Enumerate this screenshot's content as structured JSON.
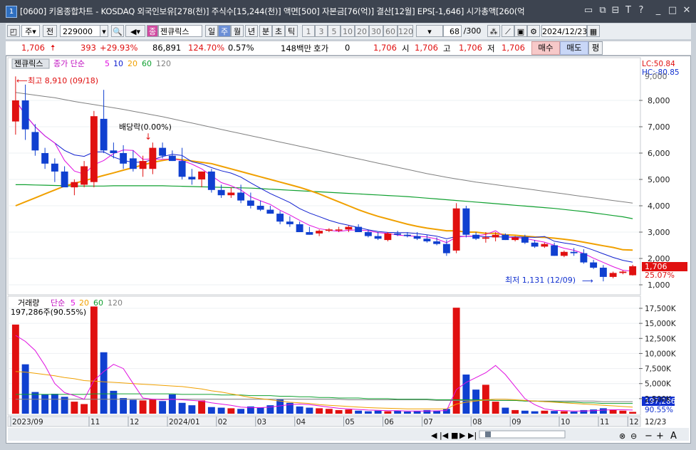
{
  "title": {
    "window_number": "1",
    "text": "[0600] 키움종합차트 - KOSDAQ 외국인보유[278(천)] 주식수[15,244(천)] 액면[500] 자본금[76(억)] 결산[12월] EPS[-1,646] 시가총액[260(억"
  },
  "toolbar": {
    "period": "주",
    "prev": "전",
    "code": "229000",
    "stock_badge": "종",
    "stock_name": "젠큐릭스",
    "tf_day": "일",
    "tf_week": "주",
    "tf_month": "월",
    "tf_year": "년",
    "tf_min": "분",
    "tf_sec": "초",
    "tf_tick": "틱",
    "intervals": [
      "1",
      "3",
      "5",
      "10",
      "20",
      "30",
      "60",
      "120"
    ],
    "count": "68",
    "count_total": "/300",
    "date": "2024/12/23"
  },
  "quote": {
    "price": "1,706",
    "change": "393",
    "change_pct": "+29.93%",
    "volume": "86,891",
    "vol_ratio": "124.70%",
    "turnover": "0.57%",
    "amount": "148백만",
    "hoga_label": "호가",
    "hoga_value": "0",
    "hoga_price": "1,706",
    "open_label": "시",
    "open": "1,706",
    "high_label": "고",
    "high": "1,706",
    "low_label": "저",
    "low": "1,706",
    "buy_label": "매수",
    "sell_label": "매도",
    "avg_label": "평"
  },
  "price_panel": {
    "name_tag": "젠큐릭스",
    "legend_prefix": "종가 단순",
    "ma_periods": [
      "5",
      "10",
      "20",
      "60",
      "120"
    ],
    "ma_colors": [
      "#e010e0",
      "#1020d0",
      "#f0a000",
      "#10a030",
      "#808080"
    ],
    "lc": "LC:50.84",
    "hc": "HC:-80.85",
    "high_note": "최고 8,910 (09/18)",
    "dividend_note": "배당락(0.00%)",
    "low_note": "최저 1,131 (12/09)",
    "last_price": "1,706",
    "last_pct": "25.07%",
    "y_labels": [
      "8,000",
      "7,000",
      "6,000",
      "5,000",
      "4,000",
      "3,000",
      "2,000",
      "1,000"
    ],
    "y_top_label": "9,000"
  },
  "volume_panel": {
    "name_tag": "거래량",
    "legend_prefix": "단순",
    "ma_periods": [
      "5",
      "20",
      "60",
      "120"
    ],
    "info": "197,286주(90.55%)",
    "y_labels": [
      "17,500K",
      "15,000K",
      "12,500K",
      "10,000K",
      "7,500K",
      "5,000K",
      "2,500K"
    ],
    "last_volume": "197,286",
    "last_pct": "90.55%"
  },
  "x_axis": {
    "labels": [
      "2023/09",
      "11",
      "12",
      "2024/01",
      "02",
      "03",
      "04",
      "05",
      "06",
      "07",
      "08",
      "09",
      "10",
      "11",
      "12",
      "12/23"
    ]
  },
  "chart_data": {
    "type": "candlestick",
    "weeks": [
      {
        "o": 7200,
        "h": 8910,
        "l": 6700,
        "c": 8000
      },
      {
        "o": 8000,
        "h": 8600,
        "l": 6500,
        "c": 6900
      },
      {
        "o": 6800,
        "h": 7100,
        "l": 5900,
        "c": 6100
      },
      {
        "o": 6000,
        "h": 6200,
        "l": 5400,
        "c": 5600
      },
      {
        "o": 5600,
        "h": 5800,
        "l": 4900,
        "c": 5300
      },
      {
        "o": 5300,
        "h": 5500,
        "l": 4800,
        "c": 4700
      },
      {
        "o": 4700,
        "h": 5000,
        "l": 4400,
        "c": 4900
      },
      {
        "o": 4800,
        "h": 5700,
        "l": 4700,
        "c": 5500
      },
      {
        "o": 4900,
        "h": 7600,
        "l": 4700,
        "c": 7400
      },
      {
        "o": 7300,
        "h": 8400,
        "l": 6000,
        "c": 6100
      },
      {
        "o": 6100,
        "h": 6400,
        "l": 5800,
        "c": 6000
      },
      {
        "o": 6000,
        "h": 6300,
        "l": 5400,
        "c": 5600
      },
      {
        "o": 5800,
        "h": 6100,
        "l": 5300,
        "c": 5400
      },
      {
        "o": 5400,
        "h": 5900,
        "l": 5100,
        "c": 5700
      },
      {
        "o": 5400,
        "h": 6400,
        "l": 5200,
        "c": 6200
      },
      {
        "o": 6200,
        "h": 6400,
        "l": 5800,
        "c": 5900
      },
      {
        "o": 5900,
        "h": 6100,
        "l": 5700,
        "c": 5700
      },
      {
        "o": 5700,
        "h": 6200,
        "l": 5000,
        "c": 5100
      },
      {
        "o": 5100,
        "h": 5400,
        "l": 4800,
        "c": 5000
      },
      {
        "o": 5000,
        "h": 5300,
        "l": 4700,
        "c": 5300
      },
      {
        "o": 5300,
        "h": 5400,
        "l": 4500,
        "c": 4600
      },
      {
        "o": 4600,
        "h": 4800,
        "l": 4300,
        "c": 4400
      },
      {
        "o": 4400,
        "h": 4700,
        "l": 4300,
        "c": 4500
      },
      {
        "o": 4500,
        "h": 4800,
        "l": 4100,
        "c": 4200
      },
      {
        "o": 4200,
        "h": 4500,
        "l": 3900,
        "c": 4000
      },
      {
        "o": 4000,
        "h": 4200,
        "l": 3800,
        "c": 3850
      },
      {
        "o": 3850,
        "h": 4000,
        "l": 3700,
        "c": 3700
      },
      {
        "o": 3700,
        "h": 3800,
        "l": 3300,
        "c": 3400
      },
      {
        "o": 3400,
        "h": 3600,
        "l": 3200,
        "c": 3300
      },
      {
        "o": 3300,
        "h": 3400,
        "l": 3000,
        "c": 3000
      },
      {
        "o": 3000,
        "h": 3200,
        "l": 2900,
        "c": 2900
      },
      {
        "o": 2950,
        "h": 3100,
        "l": 2850,
        "c": 3050
      },
      {
        "o": 3050,
        "h": 3150,
        "l": 3000,
        "c": 3100
      },
      {
        "o": 3100,
        "h": 3200,
        "l": 3000,
        "c": 3100
      },
      {
        "o": 3100,
        "h": 3250,
        "l": 3000,
        "c": 3200
      },
      {
        "o": 3200,
        "h": 3300,
        "l": 3000,
        "c": 3000
      },
      {
        "o": 3000,
        "h": 3100,
        "l": 2800,
        "c": 2850
      },
      {
        "o": 2850,
        "h": 3000,
        "l": 2700,
        "c": 2750
      },
      {
        "o": 2700,
        "h": 3000,
        "l": 2650,
        "c": 2950
      },
      {
        "o": 2950,
        "h": 3050,
        "l": 2850,
        "c": 2900
      },
      {
        "o": 2900,
        "h": 3000,
        "l": 2800,
        "c": 2850
      },
      {
        "o": 2850,
        "h": 3000,
        "l": 2700,
        "c": 2750
      },
      {
        "o": 2750,
        "h": 2900,
        "l": 2600,
        "c": 2650
      },
      {
        "o": 2650,
        "h": 2800,
        "l": 2500,
        "c": 2550
      },
      {
        "o": 2550,
        "h": 2700,
        "l": 2100,
        "c": 2200
      },
      {
        "o": 2300,
        "h": 4100,
        "l": 2200,
        "c": 3900
      },
      {
        "o": 3900,
        "h": 4000,
        "l": 2800,
        "c": 2900
      },
      {
        "o": 2900,
        "h": 3000,
        "l": 2700,
        "c": 2750
      },
      {
        "o": 2750,
        "h": 3000,
        "l": 2600,
        "c": 2800
      },
      {
        "o": 2800,
        "h": 3000,
        "l": 2650,
        "c": 2900
      },
      {
        "o": 2900,
        "h": 2950,
        "l": 2700,
        "c": 2700
      },
      {
        "o": 2700,
        "h": 2850,
        "l": 2650,
        "c": 2800
      },
      {
        "o": 2800,
        "h": 2900,
        "l": 2550,
        "c": 2600
      },
      {
        "o": 2600,
        "h": 2700,
        "l": 2400,
        "c": 2450
      },
      {
        "o": 2450,
        "h": 2600,
        "l": 2400,
        "c": 2550
      },
      {
        "o": 2500,
        "h": 2600,
        "l": 2100,
        "c": 2100
      },
      {
        "o": 2100,
        "h": 2300,
        "l": 2050,
        "c": 2250
      },
      {
        "o": 2250,
        "h": 2400,
        "l": 2100,
        "c": 2200
      },
      {
        "o": 2200,
        "h": 2350,
        "l": 1800,
        "c": 1850
      },
      {
        "o": 1850,
        "h": 1950,
        "l": 1600,
        "c": 1650
      },
      {
        "o": 1650,
        "h": 1750,
        "l": 1131,
        "c": 1300
      },
      {
        "o": 1300,
        "h": 1500,
        "l": 1250,
        "c": 1450
      },
      {
        "o": 1450,
        "h": 1550,
        "l": 1400,
        "c": 1500
      },
      {
        "o": 1364,
        "h": 1760,
        "l": 1350,
        "c": 1706
      }
    ],
    "volume_k": [
      14800,
      8200,
      3600,
      3200,
      3300,
      2800,
      2000,
      1600,
      17800,
      10200,
      3800,
      2600,
      2300,
      2200,
      2400,
      2100,
      3200,
      1800,
      1400,
      2200,
      1100,
      1000,
      900,
      800,
      1200,
      1000,
      1400,
      2400,
      1800,
      1200,
      1000,
      900,
      800,
      600,
      700,
      500,
      400,
      500,
      400,
      500,
      350,
      400,
      600,
      500,
      800,
      17600,
      6500,
      4000,
      4800,
      2000,
      1000,
      600,
      500,
      400,
      500,
      450,
      400,
      350,
      600,
      700,
      900,
      700,
      500,
      300
    ],
    "ma_volume_5_k": [
      13000,
      12000,
      10500,
      8000,
      5000,
      3500,
      3000,
      2400,
      5500,
      7000,
      8200,
      7500,
      5000,
      2600,
      2400,
      2300,
      2400,
      2300,
      2200,
      2100,
      1800,
      1600,
      1400,
      1100,
      1000,
      1000,
      1100,
      1300,
      1500,
      1600,
      1500,
      1300,
      1100,
      900,
      800,
      700,
      600,
      550,
      500,
      500,
      450,
      450,
      450,
      470,
      520,
      4000,
      5200,
      6000,
      6800,
      8000,
      6500,
      4500,
      2500,
      1500,
      800,
      550,
      500,
      450,
      450,
      500,
      600,
      650,
      650,
      600
    ],
    "ma_volume_20_k": [
      7000,
      6900,
      6700,
      6500,
      6300,
      6000,
      5800,
      5500,
      5400,
      5300,
      5200,
      5100,
      5000,
      4900,
      4800,
      4700,
      4600,
      4500,
      4300,
      4100,
      3800,
      3600,
      3300,
      3000,
      2700,
      2500,
      2300,
      2100,
      1900,
      1800,
      1700,
      1500,
      1400,
      1300,
      1200,
      1100,
      1000,
      950,
      900,
      850,
      800,
      800,
      800,
      800,
      800,
      1600,
      1900,
      2100,
      2300,
      2400,
      2400,
      2300,
      2200,
      2100,
      2000,
      1900,
      1800,
      1700,
      1600,
      1500,
      1400,
      1300,
      1200,
      1100
    ],
    "ma_volume_60_k": [
      3200,
      3200,
      3200,
      3200,
      3200,
      3200,
      3200,
      3200,
      3300,
      3300,
      3300,
      3300,
      3300,
      3300,
      3300,
      3300,
      3300,
      3200,
      3200,
      3200,
      3200,
      3100,
      3100,
      3100,
      3000,
      3000,
      3000,
      2900,
      2900,
      2800,
      2800,
      2700,
      2700,
      2600,
      2600,
      2600,
      2500,
      2500,
      2500,
      2400,
      2400,
      2400,
      2400,
      2300,
      2300,
      2300,
      2300,
      2300,
      2300,
      2200,
      2200,
      2200,
      2100,
      2100,
      2000,
      2000,
      1900,
      1900,
      1800,
      1800,
      1700,
      1700,
      1700,
      1700
    ],
    "ma_volume_120_k": [
      2400,
      2400,
      2400,
      2400,
      2400,
      2400,
      2400,
      2400,
      2400,
      2400,
      2400,
      2400,
      2400,
      2400,
      2400,
      2400,
      2400,
      2400,
      2400,
      2400,
      2400,
      2400,
      2400,
      2400,
      2400,
      2400,
      2400,
      2400,
      2400,
      2400,
      2400,
      2400,
      2400,
      2400,
      2300,
      2300,
      2300,
      2300,
      2300,
      2300,
      2300,
      2300,
      2300,
      2200,
      2200,
      2200,
      2200,
      2200,
      2200,
      2200,
      2200,
      2200,
      2100,
      2100,
      2100,
      2100,
      2100,
      2100,
      2100,
      2100,
      2000,
      2000,
      2000,
      2000
    ],
    "ma20_price": [
      4000,
      4150,
      4300,
      4450,
      4600,
      4750,
      4850,
      4950,
      5050,
      5150,
      5250,
      5350,
      5450,
      5550,
      5650,
      5720,
      5780,
      5750,
      5700,
      5650,
      5600,
      5500,
      5400,
      5300,
      5200,
      5100,
      5000,
      4900,
      4800,
      4700,
      4580,
      4450,
      4300,
      4150,
      4000,
      3850,
      3720,
      3600,
      3500,
      3400,
      3300,
      3220,
      3150,
      3100,
      3050,
      3050,
      3000,
      3000,
      2950,
      2950,
      2900,
      2880,
      2850,
      2820,
      2800,
      2770,
      2730,
      2680,
      2620,
      2550,
      2480,
      2420,
      2330,
      2320
    ],
    "ma60_price": [
      4800,
      4800,
      4790,
      4780,
      4770,
      4760,
      4750,
      4750,
      4750,
      4750,
      4760,
      4760,
      4760,
      4760,
      4760,
      4760,
      4750,
      4740,
      4730,
      4720,
      4710,
      4700,
      4690,
      4680,
      4670,
      4650,
      4630,
      4610,
      4590,
      4570,
      4550,
      4530,
      4510,
      4490,
      4470,
      4450,
      4430,
      4410,
      4390,
      4370,
      4350,
      4320,
      4290,
      4260,
      4230,
      4200,
      4170,
      4140,
      4110,
      4080,
      4050,
      4020,
      3990,
      3960,
      3930,
      3900,
      3860,
      3820,
      3780,
      3730,
      3680,
      3630,
      3580,
      3510
    ],
    "ma120_price": [
      8300,
      8250,
      8200,
      8150,
      8100,
      8030,
      7960,
      7900,
      7840,
      7780,
      7720,
      7660,
      7590,
      7520,
      7450,
      7380,
      7300,
      7220,
      7140,
      7060,
      6980,
      6900,
      6820,
      6740,
      6660,
      6580,
      6500,
      6420,
      6340,
      6260,
      6180,
      6100,
      6020,
      5940,
      5860,
      5780,
      5700,
      5620,
      5540,
      5460,
      5380,
      5300,
      5220,
      5150,
      5080,
      5020,
      4960,
      4900,
      4850,
      4800,
      4750,
      4700,
      4650,
      4600,
      4550,
      4500,
      4450,
      4400,
      4350,
      4300,
      4250,
      4200,
      4150,
      4100
    ]
  }
}
